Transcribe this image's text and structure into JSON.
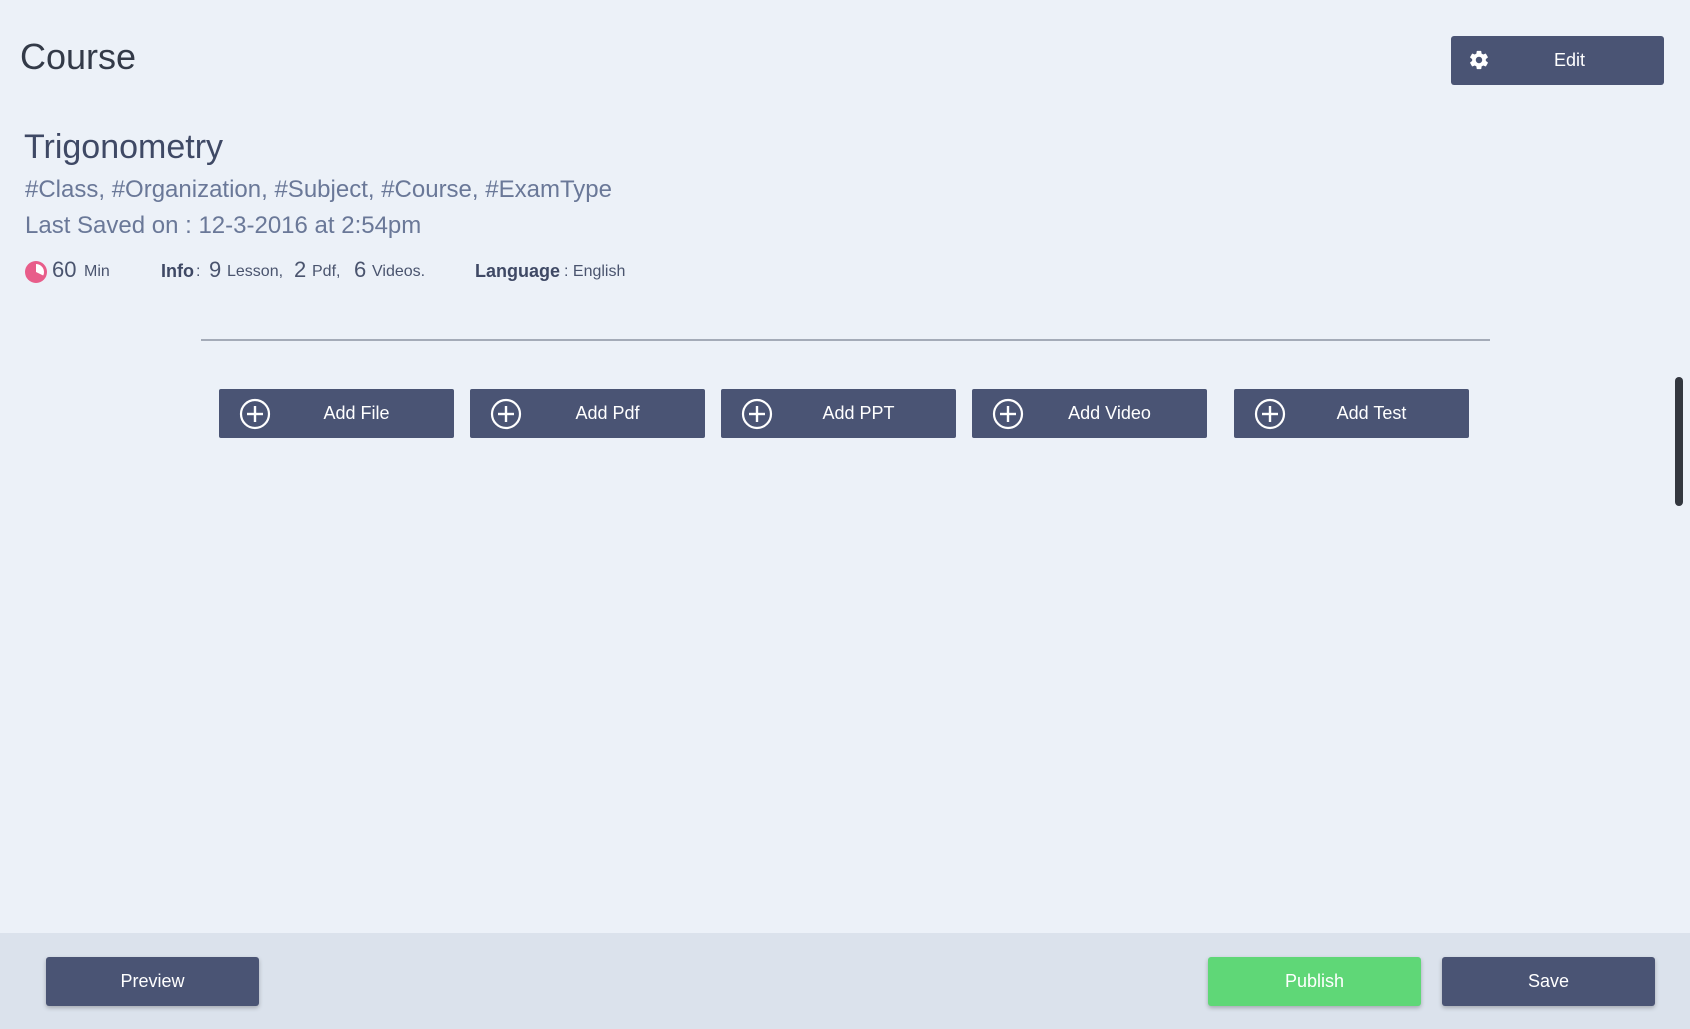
{
  "header": {
    "title": "Course",
    "edit_label": "Edit"
  },
  "course": {
    "name": "Trigonometry",
    "tags": "#Class, #Organization, #Subject, #Course, #ExamType",
    "last_saved": "Last Saved on : 12-3-2016 at 2:54pm",
    "duration_value": "60",
    "duration_unit": "Min",
    "info_label": "Info",
    "info_separator": ":",
    "lesson_count": "9",
    "lesson_unit": "Lesson,",
    "pdf_count": "2",
    "pdf_unit": "Pdf,",
    "video_count": "6",
    "video_unit": "Videos.",
    "language_label": "Language",
    "language_value": ": English"
  },
  "actions": {
    "add_file": "Add File",
    "add_pdf": "Add Pdf",
    "add_ppt": "Add PPT",
    "add_video": "Add Video",
    "add_test": "Add Test"
  },
  "footer": {
    "preview": "Preview",
    "publish": "Publish",
    "save": "Save"
  },
  "colors": {
    "primary": "#4a5474",
    "publish": "#5fd777",
    "clock": "#e85d8a",
    "background": "#ecf1f8"
  },
  "icons": {
    "edit": "gear-icon",
    "duration": "clock-icon",
    "add": "plus-circle-icon"
  }
}
